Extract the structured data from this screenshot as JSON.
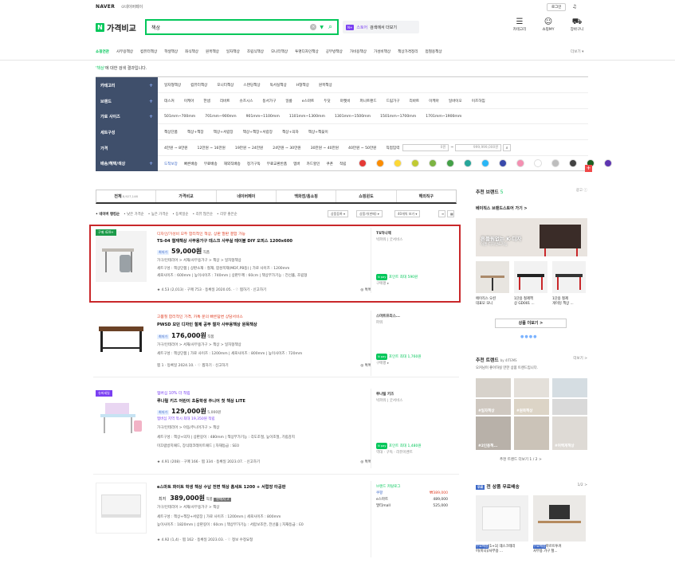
{
  "topbar": {
    "naver": "NAVER",
    "naverpay": "⊙네이버페이",
    "login": "로그인",
    "notif": "♫"
  },
  "header": {
    "logo_n": "N",
    "logo_text": "가격비교",
    "search_value": "책상",
    "store_badge": "N+",
    "store_text": "스토어",
    "store_sub": "검색에서 더보기",
    "icons": [
      {
        "label": "카테고리",
        "glyph": "☰"
      },
      {
        "label": "쇼핑MY",
        "glyph": "☺"
      },
      {
        "label": "장바구니",
        "glyph": "⛟"
      }
    ]
  },
  "catnav": [
    "쇼핑연관",
    "사무용책상",
    "컴퓨터책상",
    "학생책상",
    "좌식책상",
    "원목책상",
    "일자책상",
    "조립식책상",
    "모니터책상",
    "투명디자인책상",
    "공부방책상",
    "가비용책상",
    "가성비책상",
    "책상가격정리",
    "접철용책상"
  ],
  "catmore": "더보기 ▾",
  "result_msg": {
    "query": "'책상'",
    "rest": "에 대한 검색 결과입니다."
  },
  "filters": [
    {
      "label": "카테고리",
      "plus": "+",
      "values": [
        "일자형책상",
        "컴퓨터책상",
        "모니터책상",
        "스탠딩책상",
        "독서실책상",
        "H형책상",
        "원목책상"
      ]
    },
    {
      "label": "브랜드",
      "plus": "+",
      "values": [
        "데스커",
        "이케아",
        "한샘",
        "리바트",
        "슈즈시스",
        "동서가구",
        "일룸",
        "e스마트",
        "두닷",
        "마켓비",
        "퍼니트랜드",
        "드림가구",
        "리바트",
        "이케아",
        "일바이오",
        "이즈하임"
      ]
    },
    {
      "label": "가로 사이즈",
      "plus": "+",
      "values": [
        "501mm~700mm",
        "701mm~900mm",
        "901mm~1100mm",
        "1101mm~1300mm",
        "1301mm~1500mm",
        "1501mm~1700mm",
        "1701mm~1900mm"
      ]
    },
    {
      "label": "세트구성",
      "plus": "",
      "values": [
        "책상단품",
        "책상+책장",
        "책상+서랍장",
        "책상+책장+서랍장",
        "책상+의자",
        "책상+책꽂이"
      ]
    },
    {
      "label": "가격",
      "plus": "",
      "values": [
        "4만원 ~ 8만원",
        "12만원 ~ 16만원",
        "19만원 ~ 24만원",
        "24만원 ~ 30만원",
        "30만원 ~ 40만원",
        "40만원 ~ 50만원",
        "직접입력"
      ],
      "min_ph": "0원",
      "max_ph": "999,999,000원",
      "go": "⌕"
    },
    {
      "label": "배송/혜택/색상",
      "plus": "+",
      "values": [
        "도착보장",
        "빠른배송",
        "무료배송",
        "해외직배송",
        "정기구독",
        "무료교환반품",
        "멤버",
        "카드할인",
        "쿠폰",
        "적립"
      ]
    }
  ],
  "colors": [
    "#e53935",
    "#fb8c00",
    "#fdd835",
    "#c0ca33",
    "#7cb342",
    "#43a047",
    "#26a69a",
    "#29b6f6",
    "#3949ab",
    "#f48fb1",
    "#ffffff",
    "#bdbdbd",
    "#424242",
    "#1b5e20",
    "#5e35b1"
  ],
  "tabs": [
    {
      "label": "전체",
      "count": "8,927,146"
    },
    {
      "label": "가격비교",
      "count": ""
    },
    {
      "label": "네이버페이",
      "count": ""
    },
    {
      "label": "백화점/홈쇼핑",
      "count": ""
    },
    {
      "label": "쇼핑윈도",
      "count": ""
    },
    {
      "label": "해외직구",
      "count": ""
    }
  ],
  "sortbar": [
    "• 네이버 랭킹순",
    "• 낮은 가격순",
    "• 높은 가격순",
    "• 등록일순",
    "• 리뷰 많은순",
    "• 리뷰 좋은순"
  ],
  "selects": [
    "상품등록 ▾",
    "상품가(판매) ▾",
    "40개씩 보기 ▾",
    "≡",
    "▦"
  ],
  "products": [
    {
      "badge": "구매 420+",
      "ad": "디자인/가성비 모두 합리적인 책상, 상판 말판 결합 가능",
      "title": "TS-04 철재책상 사무용가구 데스크 사무실 테이블 DIY 오피스 1200x600",
      "tag": "최저가",
      "price": "59,000원",
      "unit": "직품",
      "cat": "가구/인테리어 > 서재/사무용가구 > 책상 > 일자형책상",
      "spec1": "세트구성 : 책상단품  |  상판소재 : 철재, 합성목재(MDF,PB등)  |  가로 사이즈 : 1200mm",
      "spec2": "세로사이즈 : 600mm  |  높이사이즈 : 740mm  |  상판두께 : 60cm  |  책상부가기능 : 전선홀, 조립형",
      "meta": "★ 4.53  (2,013)  ·  구매 753  ·  등록일 2020.05.  ·  ♡ 찜하기  ·  신고하기",
      "compare": "◎ 톡톡",
      "shop": "TS하나제",
      "shop_sub": "빅파워  |  굿서비스",
      "np": "N pay",
      "np_text": "포인트 최대 590원",
      "extra": "구매평 ▸"
    },
    {
      "badge": "",
      "ad": "고품질 합리적인 가격, 카톡 문의 빠른답변 상담서비스",
      "title": "PWSD 모던 디자인 철제 공부 철자 사무용책상 원목책상",
      "tag": "최저가",
      "price": "176,000원",
      "unit": "직품",
      "cat": "가구/인테리어 > 서재/사무용가구 > 책상 > 일자형책상",
      "spec1": "세트구성 : 책상단품  |  가로 사이즈 : 1200mm  |  세로사이즈 : 800mm  |  높이사이즈 : 720mm",
      "spec2": "",
      "meta": "찜 1  ·  등록일 2024.10.  ·  ♡ 찜하기  ·  신고하기",
      "compare": "◎ 톡톡",
      "shop": "스마트프리스...",
      "shop_sub": "파워",
      "np": "N pay",
      "np_text": "포인트 최대 1,760원",
      "extra": "구매평 ▸"
    },
    {
      "badge": "슈퍼세일",
      "ad": "멤버십 10% 더 적립",
      "title": "루나릴 키즈 어린이 초등학생 주니어 첫 책상 LITE",
      "tag": "최저가",
      "price": "129,000원",
      "unit": "5,000원",
      "cat": "멤버십 지역 적시 최대 19,350원 적립",
      "spec1": "가구/인테리어 > 아동/주니어가구 > 책상",
      "spec2": "세트구성 : 책상+의자  |  상판길이 : 480mm  |  책상부가기능 : 각도조절, 높이조절, 기립감지",
      "spec3": "미끄럼방지패드, 장식데코레이트패드  |  자재등급 : SE0",
      "meta": "★ 4.91  (208)  ·  구매 166  ·  찜 334  ·  등록일 2023.07.  ·  신고하기",
      "compare": "◎ 톡톡",
      "shop": "루나릴 키즈",
      "shop_sub": "빅파워  |  굿서비스",
      "np": "N pay",
      "np_text": "포인트 최대 1,480원",
      "extra": "역대  ·  구독  ·  리뷰이벤트"
    },
    {
      "badge": "",
      "ad": "",
      "title": "e스마트 화이트 학생 책상 수납 전면 책상 홈세트 1200 + 서랍장 타공판",
      "tag": "최저",
      "price": "389,000원",
      "unit": "직품",
      "mall": "판매처 3",
      "cat": "가구/인테리어 > 서재/사무용가구 > 책상",
      "spec1": "세트구성 : 책상+책장+서랍장  |  가로 사이즈 : 1200mm  |  세로사이즈 : 800mm",
      "spec2": "높이사이즈 : 1820mm  |  상판길이 : 60cm  |  책상부가기능 : 서랍보조칸, 전선홀  |  자재등급 : E0",
      "meta": "★ 4.92  (1,4)  ·  찜 162  ·  등록일 2023.03.  ·  ♡ 정보 수정요청",
      "compare": "◎ 톡톡",
      "shop": "브랜드 카탈로그",
      "shop_sub": "",
      "mall_rows": [
        {
          "name": "쿠팡",
          "price": "₩389,000"
        },
        {
          "name": "e스마트",
          "price": "489,000"
        },
        {
          "name": "멀티mall",
          "price": "525,000"
        }
      ]
    }
  ],
  "right1": {
    "title": "추천 브랜드",
    "count": "5",
    "ad": "광고 ⓘ",
    "brand": "베이직스 브랜드스토어 가기 >",
    "banner1": "흔들림없는 K-디자",
    "banner2": "이젠 디자인&기능",
    "captions": [
      "에이직스 오션\n대표모 모니",
      "1단용 철제책\n상 GD001 ...",
      "1단용 철제\n게이밍 책상 ..."
    ],
    "more": "상품 더보기 >"
  },
  "right2": {
    "title": "추천 트렌드",
    "by": "by 4ITEMS",
    "more": "더보기 >",
    "desc": "오커님이 좋아하실 만한 상품 트렌드입니다.",
    "tiles": [
      "#일자책상",
      "#원목책상",
      "#2인용책...",
      "#여백계책상"
    ],
    "pager": "추천 트렌드 더보기  1 / 2  >"
  },
  "right3": {
    "title": "전 상품 무료배송",
    "pager": "1/2 >",
    "labels": [
      {
        "tag": "무료배송",
        "name": "[1+1] 데스크테리\n어(미니)/사무용 ..."
      },
      {
        "tag": "무료배송",
        "name": "마르트투커\n사무용 가구 철..."
      }
    ]
  }
}
